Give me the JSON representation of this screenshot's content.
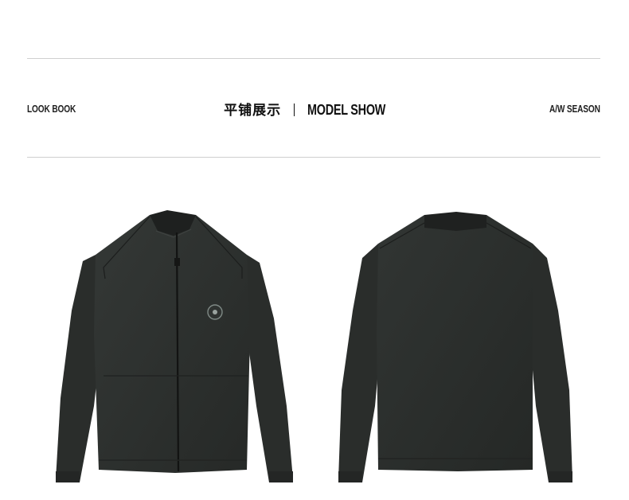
{
  "header": {
    "left_caption": "LOOK BOOK",
    "title_cn": "平铺展示",
    "title_en": "MODEL SHOW",
    "right_caption": "A/W SEASON"
  },
  "products": [
    {
      "id": "front",
      "view": "front",
      "color": "#2b2e2c"
    },
    {
      "id": "back",
      "view": "back",
      "color": "#2b2e2c"
    }
  ]
}
